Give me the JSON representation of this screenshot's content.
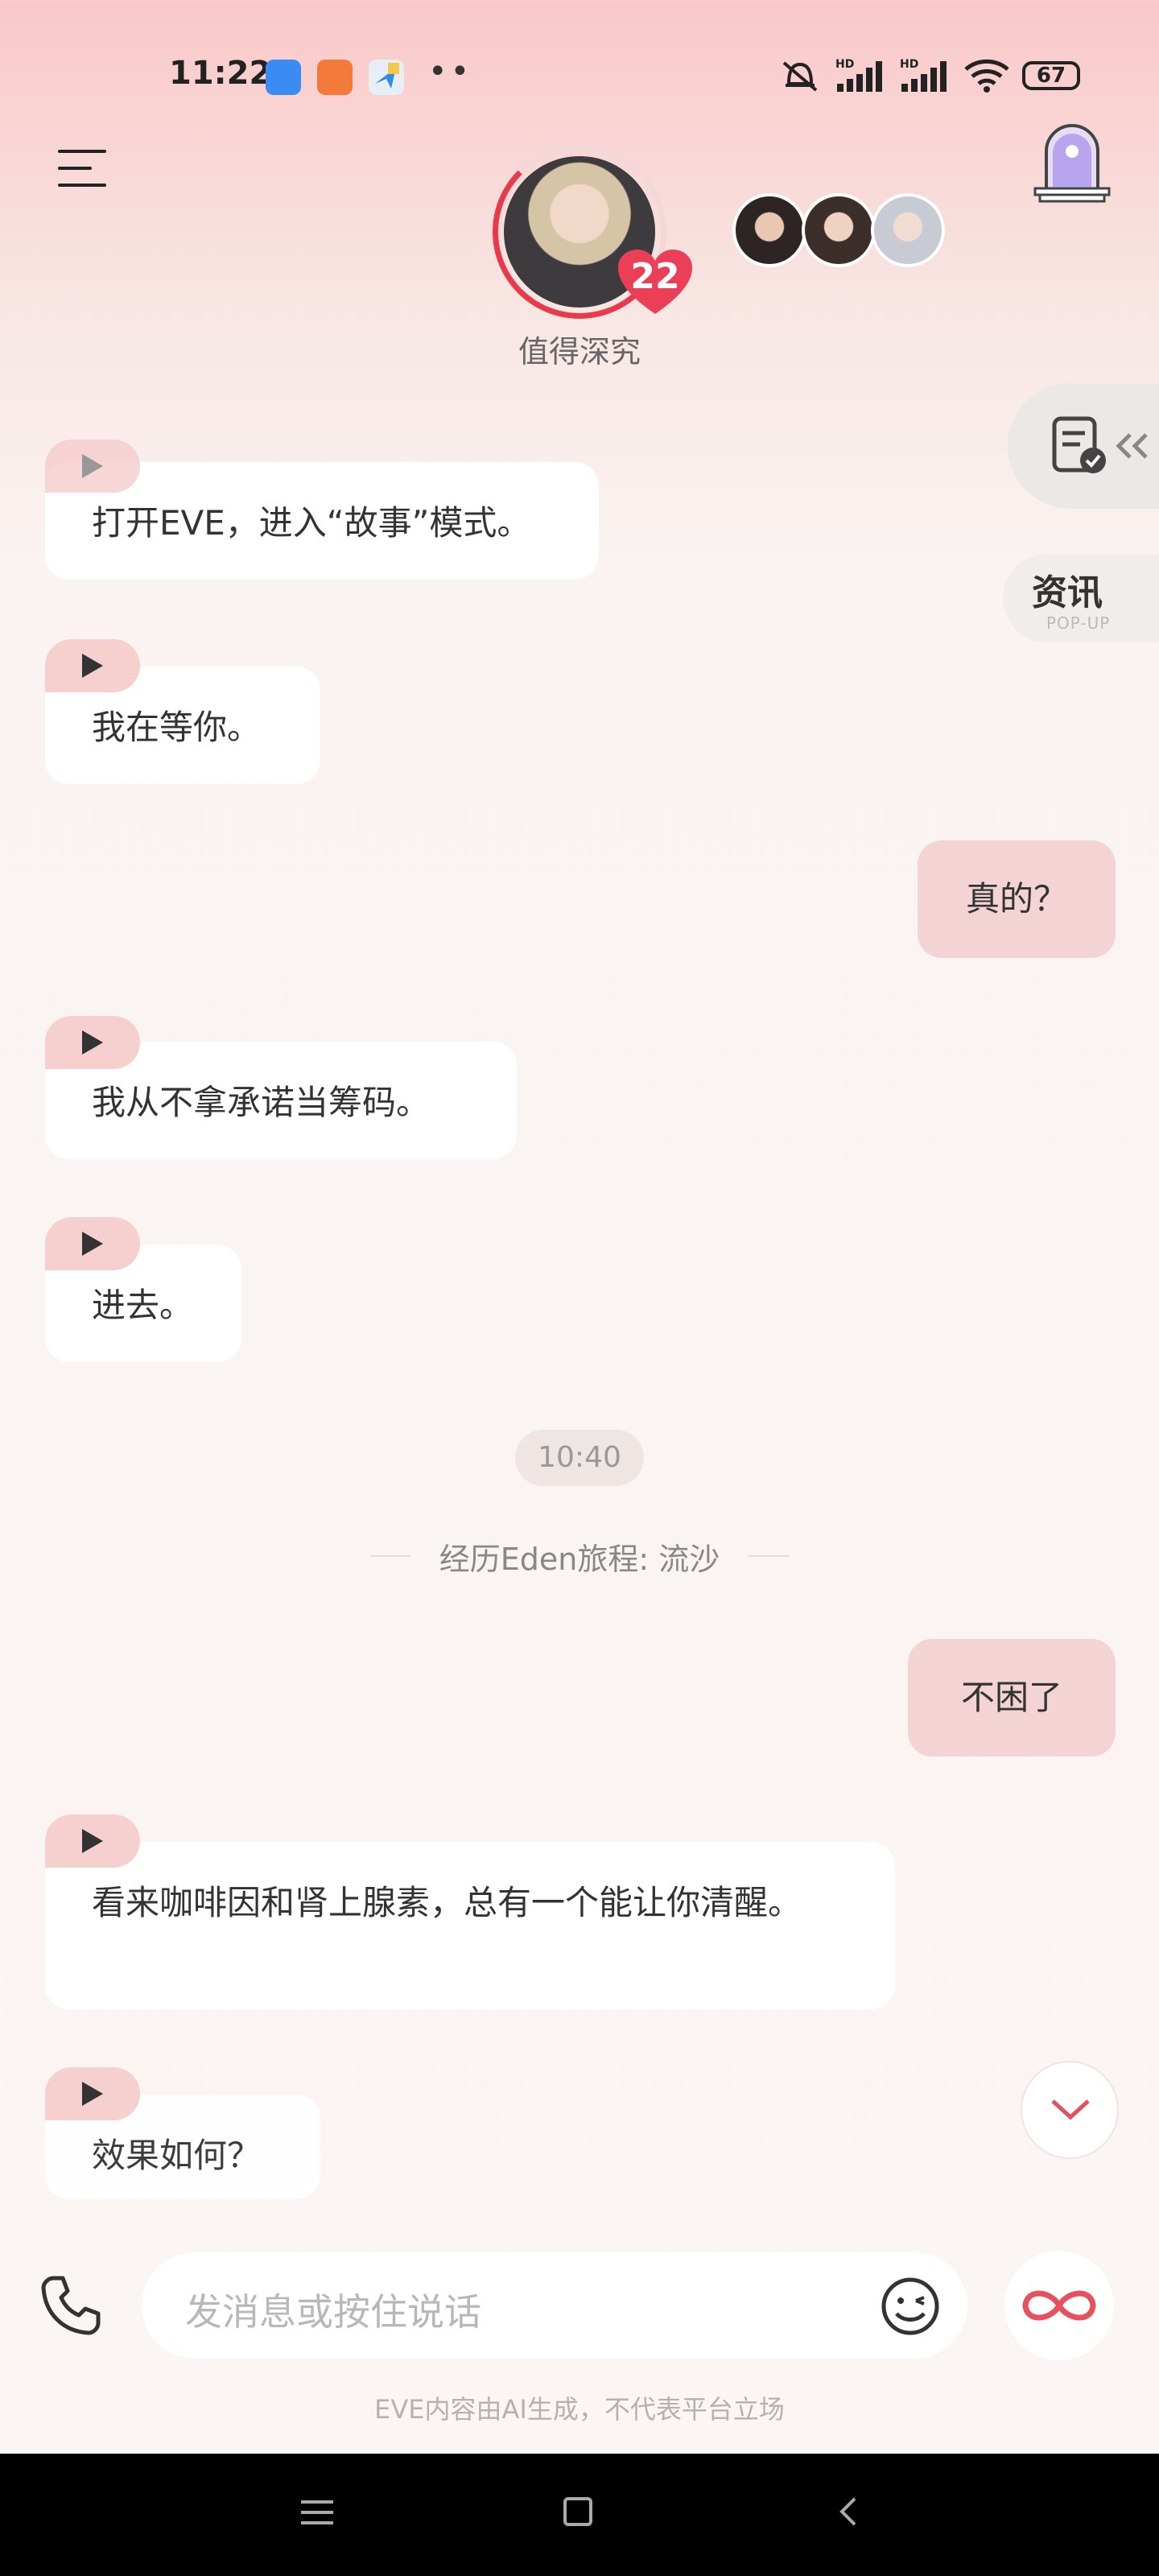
{
  "status_bar": {
    "time": "11:22",
    "battery": "67",
    "icons": [
      "calendar-app-icon",
      "mi-store-icon",
      "maps-app-icon",
      "mute-icon",
      "hd-signal-icon",
      "hd-signal-icon",
      "wifi-icon",
      "battery-icon"
    ]
  },
  "header": {
    "affection_count": "22",
    "subtitle": "值得深究",
    "accent_color": "#e83a4a"
  },
  "side": {
    "news_label": "资讯",
    "news_sub": "POP-UP"
  },
  "messages": [
    {
      "from": "bot",
      "text": "打开EVE，进入“故事”模式。"
    },
    {
      "from": "bot",
      "text": "我在等你。"
    },
    {
      "from": "user",
      "text": "真的？"
    },
    {
      "from": "bot",
      "text": "我从不拿承诺当筹码。"
    },
    {
      "from": "bot",
      "text": "进去。"
    },
    {
      "from": "user",
      "text": "不困了"
    },
    {
      "from": "bot",
      "text": "看来咖啡因和肾上腺素，总有一个能让你清醒。"
    },
    {
      "from": "bot",
      "text": "效果如何？"
    }
  ],
  "timestamp": "10:40",
  "journey": "经历Eden旅程: 流沙",
  "input": {
    "placeholder": "发消息或按住说话"
  },
  "disclaimer": "EVE内容由AI生成，不代表平台立场"
}
